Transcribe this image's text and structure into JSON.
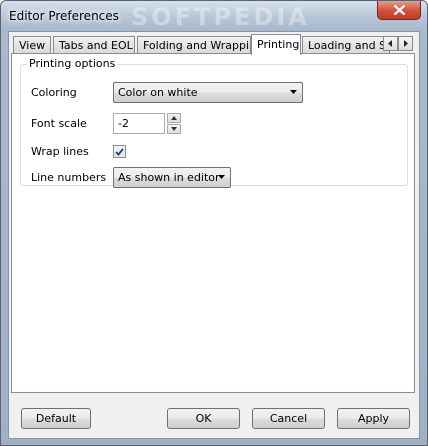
{
  "window": {
    "title": "Editor Preferences",
    "watermark": "SOFTPEDIA"
  },
  "tabs": [
    {
      "label": "View",
      "active": false
    },
    {
      "label": "Tabs and EOL",
      "active": false
    },
    {
      "label": "Folding and Wrapping",
      "active": false
    },
    {
      "label": "Printing",
      "active": true
    },
    {
      "label": "Loading and Savin",
      "active": false
    }
  ],
  "printing": {
    "group_title": "Printing options",
    "coloring": {
      "label": "Coloring",
      "value": "Color on white"
    },
    "font_scale": {
      "label": "Font scale",
      "value": "-2"
    },
    "wrap_lines": {
      "label": "Wrap lines",
      "checked": true
    },
    "line_numbers": {
      "label": "Line numbers",
      "value": "As shown in editor"
    }
  },
  "buttons": {
    "default": "Default",
    "ok": "OK",
    "cancel": "Cancel",
    "apply": "Apply"
  },
  "colors": {
    "title_bar": "#b8c8d9",
    "close_button": "#c23b22",
    "panel_background": "#f0f0f0"
  }
}
